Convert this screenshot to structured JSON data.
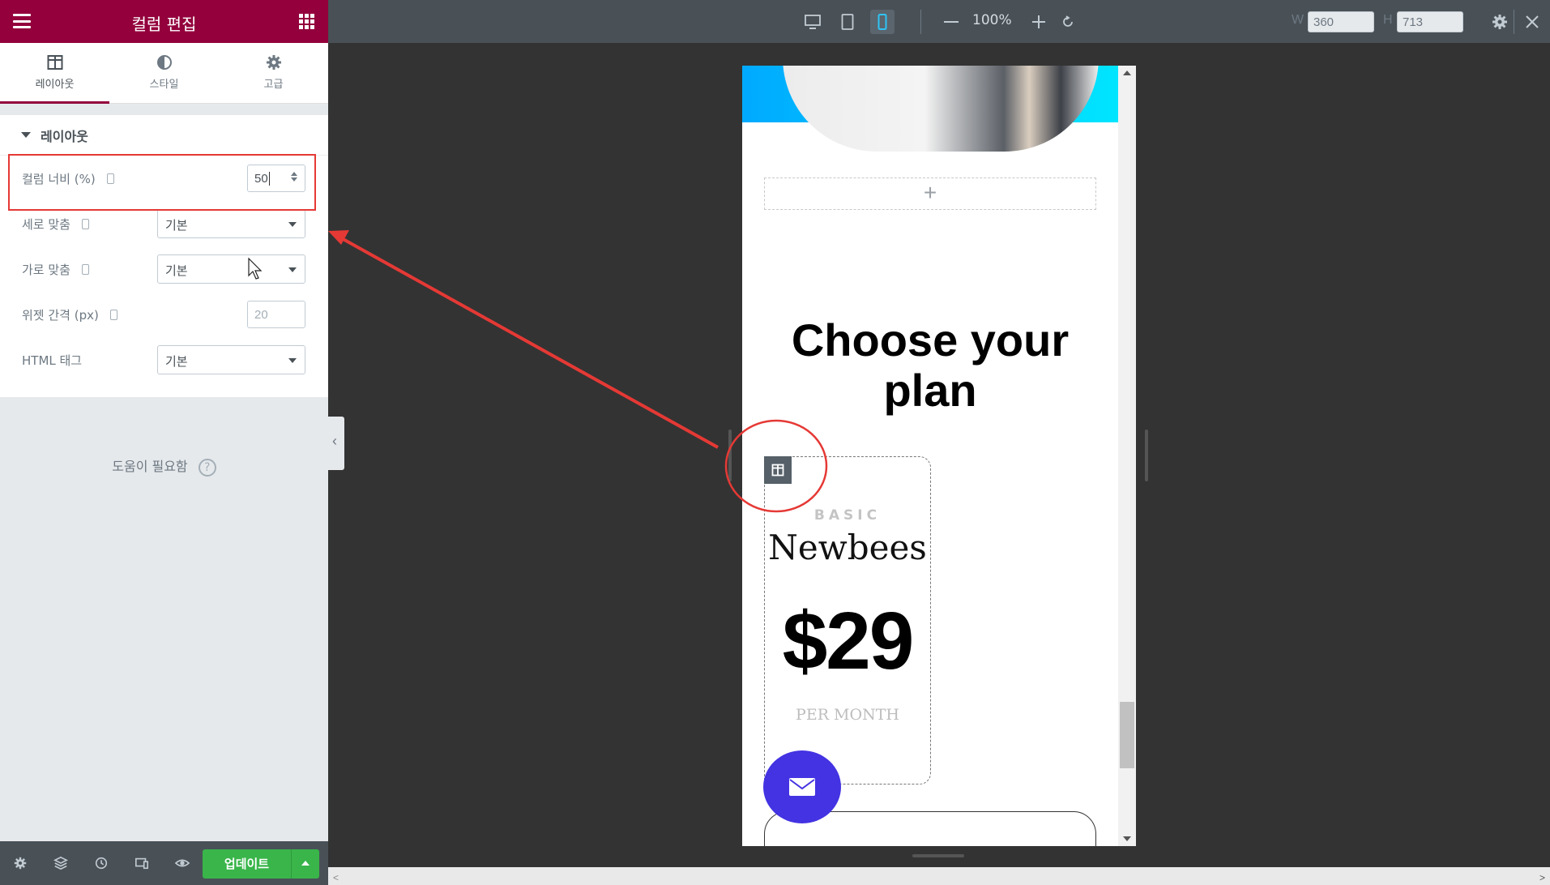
{
  "panel": {
    "title": "컬럼 편집",
    "tabs": [
      {
        "label": "레이아웃",
        "icon": "columns-icon"
      },
      {
        "label": "스타일",
        "icon": "half-circle-icon"
      },
      {
        "label": "고급",
        "icon": "gear-icon"
      }
    ],
    "section_title": "레이아웃",
    "controls": {
      "column_width": {
        "label": "컬럼 너비 (%)",
        "value": "50"
      },
      "vertical_align": {
        "label": "세로 맞춤",
        "value": "기본"
      },
      "horizontal_align": {
        "label": "가로 맞춤",
        "value": "기본"
      },
      "widget_gap": {
        "label": "위젯 간격 (px)",
        "placeholder": "20"
      },
      "html_tag": {
        "label": "HTML 태그",
        "value": "기본"
      }
    },
    "help_text": "도움이 필요함",
    "help_icon_glyph": "?",
    "update_label": "업데이트"
  },
  "toolbar": {
    "zoom": "100%",
    "width_label": "W",
    "width_value": "360",
    "height_label": "H",
    "height_value": "713"
  },
  "preview": {
    "add_glyph": "+",
    "heading": "Choose your plan",
    "plan": {
      "tier": "BASIC",
      "name": "Newbees",
      "price": "$29",
      "period": "PER MONTH"
    }
  },
  "colors": {
    "panel_header": "#93003c",
    "update_button": "#39b54a",
    "fab": "#4333e2",
    "annotation": "#e53935"
  }
}
